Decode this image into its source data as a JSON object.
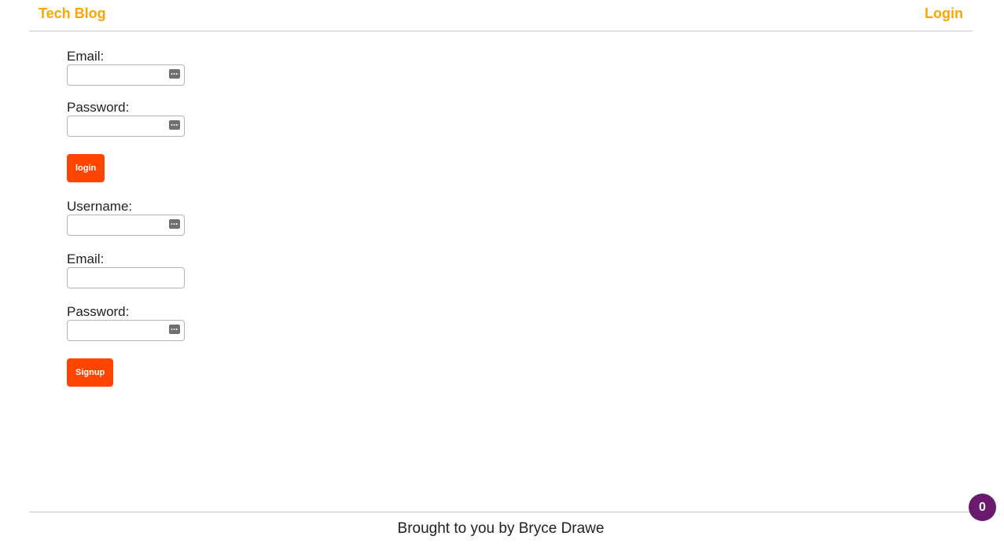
{
  "header": {
    "brand": "Tech Blog",
    "nav_login": "Login"
  },
  "login_form": {
    "email_label": "Email:",
    "email_value": "",
    "password_label": "Password:",
    "password_value": "",
    "submit_label": "login"
  },
  "signup_form": {
    "username_label": "Username:",
    "username_value": "",
    "email_label": "Email:",
    "email_value": "",
    "password_label": "Password:",
    "password_value": "",
    "submit_label": "Signup"
  },
  "footer": {
    "text": "Brought to you by Bryce Drawe"
  },
  "badge": {
    "count": "0"
  },
  "colors": {
    "brand_orange": "#ffa500",
    "button_red_orange": "#ff4500",
    "badge_purple": "#6a1b6e"
  },
  "icons": {
    "password_manager": "key-icon"
  }
}
